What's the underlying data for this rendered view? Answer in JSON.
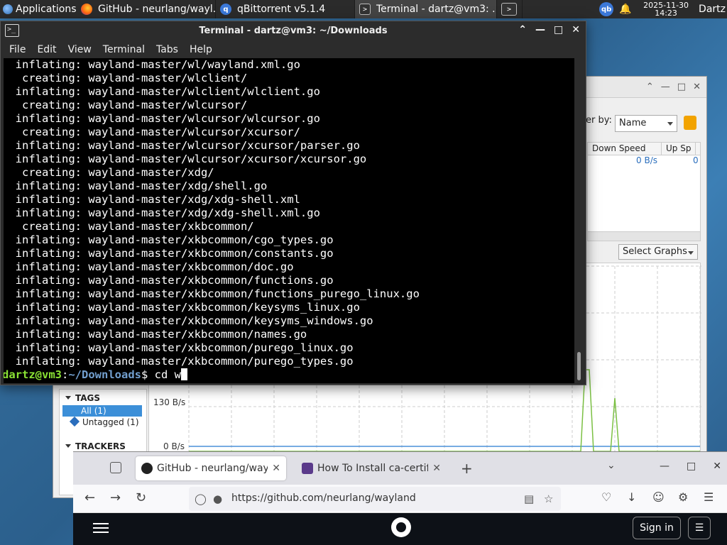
{
  "panel": {
    "apps_label": "Applications",
    "tasks": [
      {
        "label": "GitHub - neurlang/wayl...",
        "icon": "firefox-icon"
      },
      {
        "label": "qBittorrent v5.1.4",
        "icon": "qbittorrent-icon"
      },
      {
        "label": "Terminal - dartz@vm3: ...",
        "icon": "terminal-icon"
      }
    ],
    "tray_qb": "qb",
    "date": "2025-11-30",
    "time": "14:23",
    "user": "Dartz"
  },
  "qbittorrent": {
    "filter_label": "er by:",
    "filter_value": "Name",
    "columns": [
      "Down Speed",
      "Up Sp"
    ],
    "row_down_speed": "0 B/s",
    "row_up_speed": "0",
    "select_graphs": "Select Graphs",
    "sidebar": {
      "tags_heading": "TAGS",
      "all_item": "All (1)",
      "untagged_item": "Untagged (1)",
      "trackers_heading": "TRACKERS"
    },
    "graph": {
      "y_top": "130 B/s",
      "y_bottom": "0 B/s"
    }
  },
  "terminal": {
    "title": "Terminal - dartz@vm3: ~/Downloads",
    "menu": [
      "File",
      "Edit",
      "View",
      "Terminal",
      "Tabs",
      "Help"
    ],
    "lines": [
      "  inflating: wayland-master/wl/wayland.xml.go",
      "   creating: wayland-master/wlclient/",
      "  inflating: wayland-master/wlclient/wlclient.go",
      "   creating: wayland-master/wlcursor/",
      "  inflating: wayland-master/wlcursor/wlcursor.go",
      "   creating: wayland-master/wlcursor/xcursor/",
      "  inflating: wayland-master/wlcursor/xcursor/parser.go",
      "  inflating: wayland-master/wlcursor/xcursor/xcursor.go",
      "   creating: wayland-master/xdg/",
      "  inflating: wayland-master/xdg/shell.go",
      "  inflating: wayland-master/xdg/xdg-shell.xml",
      "  inflating: wayland-master/xdg/xdg-shell.xml.go",
      "   creating: wayland-master/xkbcommon/",
      "  inflating: wayland-master/xkbcommon/cgo_types.go",
      "  inflating: wayland-master/xkbcommon/constants.go",
      "  inflating: wayland-master/xkbcommon/doc.go",
      "  inflating: wayland-master/xkbcommon/functions.go",
      "  inflating: wayland-master/xkbcommon/functions_purego_linux.go",
      "  inflating: wayland-master/xkbcommon/keysyms_linux.go",
      "  inflating: wayland-master/xkbcommon/keysyms_windows.go",
      "  inflating: wayland-master/xkbcommon/names.go",
      "  inflating: wayland-master/xkbcommon/purego_linux.go",
      "  inflating: wayland-master/xkbcommon/purego_types.go"
    ],
    "prompt_user": "dartz@vm3",
    "prompt_sep": ":",
    "prompt_path": "~/Downloads",
    "prompt_dollar": "$ ",
    "command": "cd w"
  },
  "firefox": {
    "tabs": [
      {
        "label": "GitHub - neurlang/wayland",
        "active": true
      },
      {
        "label": "How To Install ca-certificates",
        "active": false
      }
    ],
    "new_tab": "+",
    "url": "https://github.com/neurlang/wayland",
    "signin": "Sign in"
  },
  "colors": {
    "prompt_user": "#8ae234",
    "prompt_path": "#729fcf",
    "graph_green": "#7bc043",
    "graph_blue": "#4a90d9",
    "github_bg": "#0d1117"
  }
}
